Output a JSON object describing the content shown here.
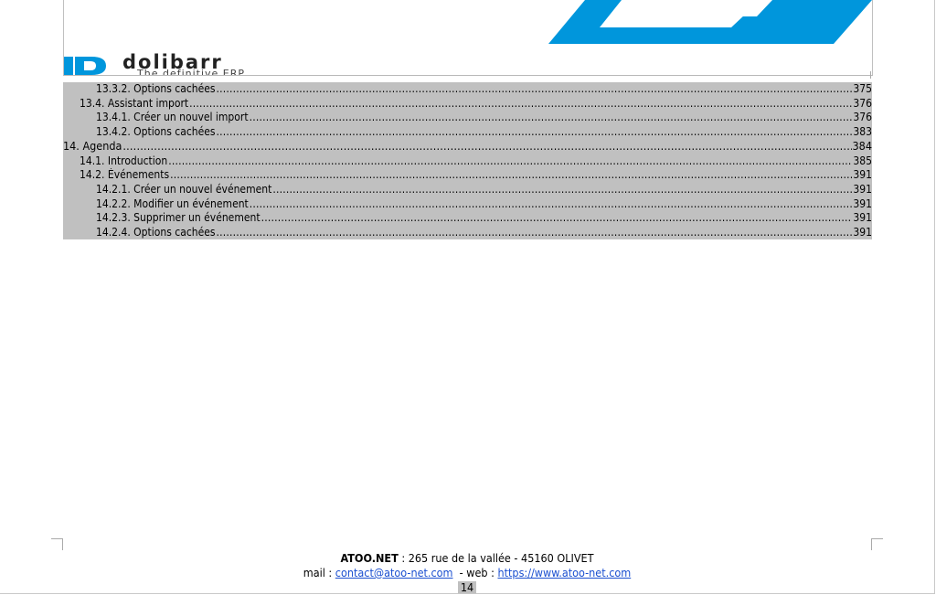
{
  "header": {
    "logo_text": "dolibarr",
    "logo_tagline": "The definitive ERP",
    "brand_color": "#0096dc"
  },
  "toc": [
    {
      "level": 3,
      "title": "13.3.2. Options cachées",
      "page": "375"
    },
    {
      "level": 2,
      "title": "13.4. Assistant import",
      "page": "376"
    },
    {
      "level": 3,
      "title": "13.4.1. Créer un nouvel import",
      "page": "376"
    },
    {
      "level": 3,
      "title": "13.4.2. Options cachées",
      "page": "383"
    },
    {
      "level": 1,
      "title": "14. Agenda",
      "page": "384"
    },
    {
      "level": 2,
      "title": "14.1. Introduction",
      "page": "385"
    },
    {
      "level": 2,
      "title": "14.2. Événements",
      "page": "391"
    },
    {
      "level": 3,
      "title": "14.2.1. Créer un nouvel événement",
      "page": "391"
    },
    {
      "level": 3,
      "title": "14.2.2. Modifier un événement",
      "page": "391"
    },
    {
      "level": 3,
      "title": "14.2.3. Supprimer un événement",
      "page": "391"
    },
    {
      "level": 3,
      "title": "14.2.4. Options cachées",
      "page": "391"
    }
  ],
  "footer": {
    "company": "ATOO.NET",
    "address": " : 265 rue de la vallée - 45160 OLIVET",
    "mail_label": "mail : ",
    "mail": "contact@atoo-net.com",
    "web_label": "  - web : ",
    "web": "https://www.atoo-net.com",
    "page_number": "14"
  }
}
